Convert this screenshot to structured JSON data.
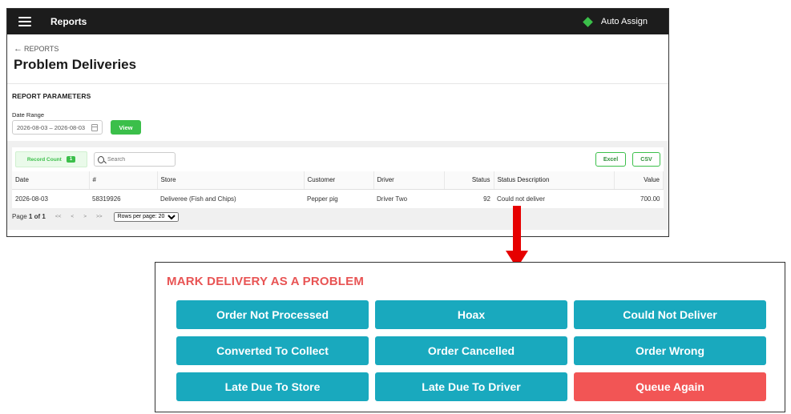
{
  "app": {
    "title": "Reports",
    "auto_assign_label": "Auto Assign",
    "back_label": "REPORTS",
    "page_title": "Problem Deliveries"
  },
  "params": {
    "title": "REPORT PARAMETERS",
    "date_label": "Date Range",
    "date_value": "2026-08-03 – 2026-08-03",
    "view_label": "View"
  },
  "toolbar": {
    "record_count_label": "Record Count",
    "record_count": "1",
    "search_placeholder": "Search",
    "excel_label": "Excel",
    "csv_label": "CSV"
  },
  "table": {
    "columns": [
      "Date",
      "#",
      "Store",
      "Customer",
      "Driver",
      "Status",
      "Status Description",
      "Value"
    ],
    "rows": [
      {
        "date": "2026-08-03",
        "num": "58319926",
        "store": "Deliveree (Fish and Chips)",
        "customer": "Pepper pig",
        "driver": "Driver Two",
        "status": "92",
        "status_description": "Could not deliver",
        "value": "700.00"
      }
    ]
  },
  "pager": {
    "page_prefix": "Page",
    "page_current": "1 of 1",
    "first": "<<",
    "prev": "<",
    "next": ">",
    "last": ">>",
    "rows_per_page": "Rows per page: 20"
  },
  "panel": {
    "title": "MARK DELIVERY AS A PROBLEM",
    "buttons": [
      "Order Not Processed",
      "Hoax",
      "Could Not Deliver",
      "Converted To Collect",
      "Order Cancelled",
      "Order Wrong",
      "Late Due To Store",
      "Late Due To Driver",
      "Queue Again"
    ]
  },
  "colors": {
    "accent_green": "#3bbf4a",
    "action_teal": "#19a9be",
    "danger_red": "#f25555",
    "arrow_red": "#e60000",
    "topbar": "#1c1c1c"
  }
}
